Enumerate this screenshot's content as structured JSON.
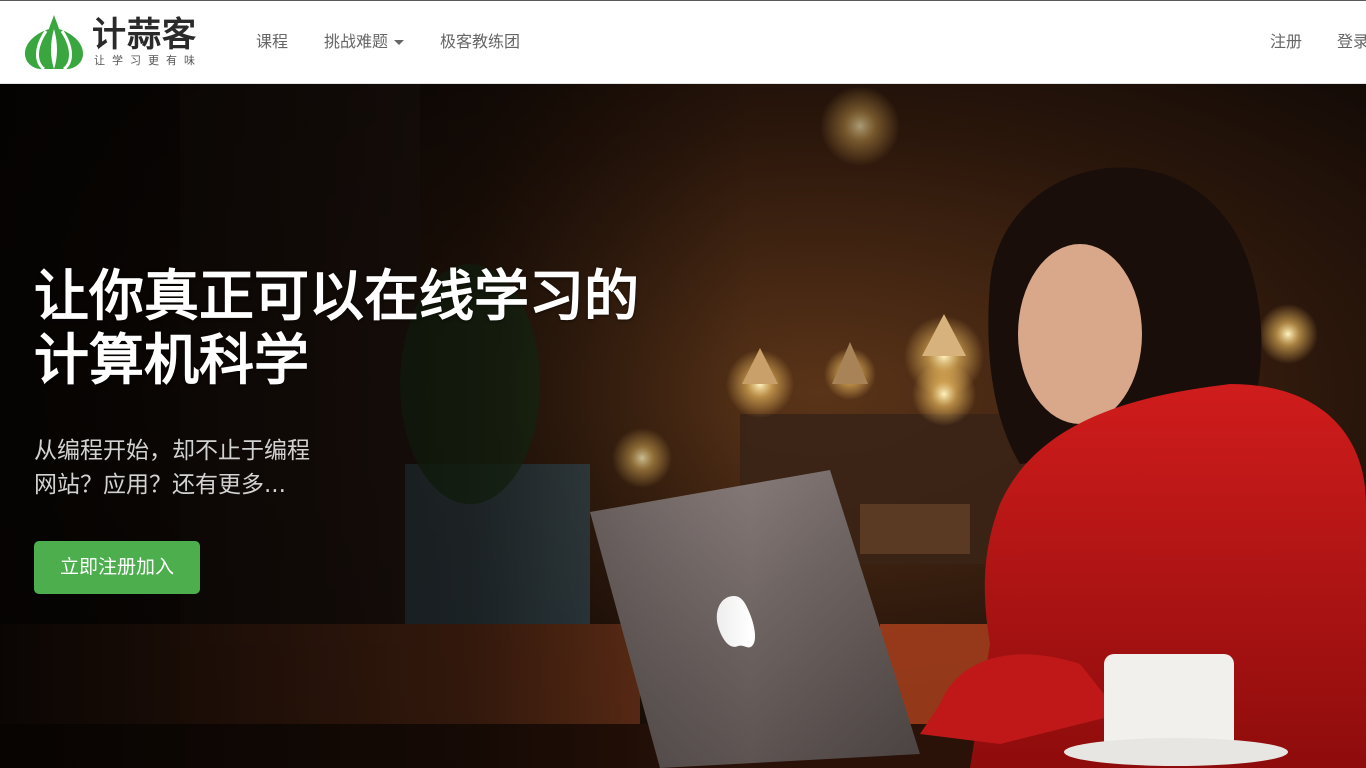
{
  "brand": {
    "name": "计蒜客",
    "slogan": "让学习更有味",
    "colors": {
      "logo_green": "#3aa640",
      "accent_green": "#4cae4c",
      "dark_text": "#2a2a2a"
    }
  },
  "nav": {
    "left": [
      {
        "label": "课程"
      },
      {
        "label": "挑战难题",
        "has_dropdown": true,
        "icon": "caret-down-icon"
      },
      {
        "label": "极客教练团"
      }
    ],
    "right": [
      {
        "label": "注册"
      },
      {
        "label": "登录"
      }
    ]
  },
  "hero": {
    "title_line1": "让你真正可以在线学习的",
    "title_line2": "计算机科学",
    "subtitle_line1": "从编程开始，却不止于编程",
    "subtitle_line2": "网站？应用？还有更多...",
    "cta_label": "立即注册加入",
    "background": "photo: woman in red sweater using laptop in warmly lit cafe"
  }
}
